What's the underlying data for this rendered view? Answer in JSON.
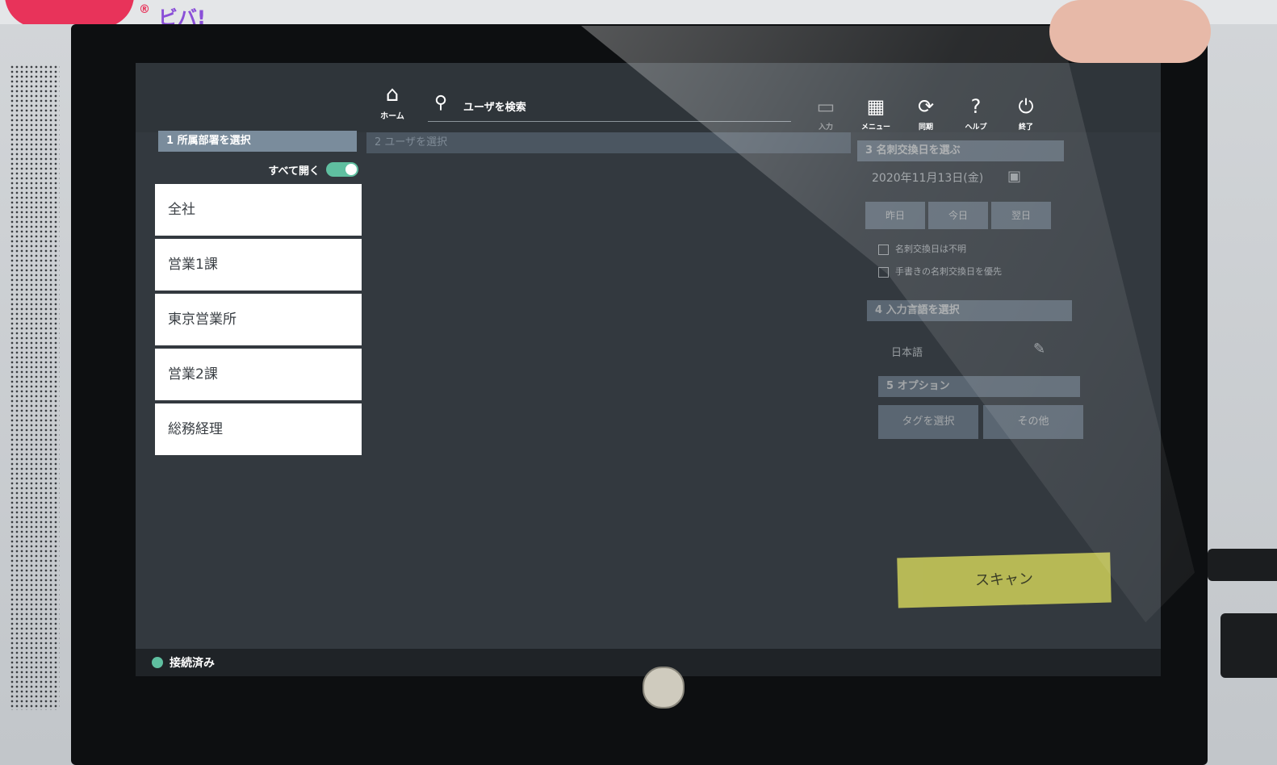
{
  "brand": {
    "registered_mark": "®",
    "name": "ビバ!"
  },
  "toolbar": {
    "home_label": "ホーム",
    "search_placeholder": "ユーザを検索",
    "tools": [
      {
        "label": "入力",
        "icon": "input-icon"
      },
      {
        "label": "メニュー",
        "icon": "grid-menu-icon"
      },
      {
        "label": "同期",
        "icon": "sync-icon"
      },
      {
        "label": "ヘルプ",
        "icon": "help-icon"
      },
      {
        "label": "終了",
        "icon": "power-icon"
      }
    ]
  },
  "sections": {
    "step1": "1 所属部署を選択",
    "step2": "2 ユーザを選択",
    "step3": "3 名刺交換日を選ぶ",
    "step4": "4 入力言語を選択",
    "step5": "5 オプション"
  },
  "expand_all": {
    "label": "すべて開く",
    "enabled": true
  },
  "departments": [
    "全社",
    "営業1課",
    "東京営業所",
    "営業2課",
    "総務経理"
  ],
  "date_panel": {
    "date": "2020年11月13日(金)",
    "nav": [
      "昨日",
      "今日",
      "翌日"
    ],
    "checks": [
      "名刺交換日は不明",
      "手書きの名刺交換日を優先"
    ]
  },
  "language": "日本語",
  "options": {
    "tag_label": "タグを選択",
    "other_label": "その他"
  },
  "scan_label": "スキャン",
  "status": {
    "text": "接続済み",
    "color": "#5fbfa0"
  },
  "colors": {
    "accent": "#7a8c9c",
    "scan": "#cfd05a",
    "screen": "#33393f"
  }
}
